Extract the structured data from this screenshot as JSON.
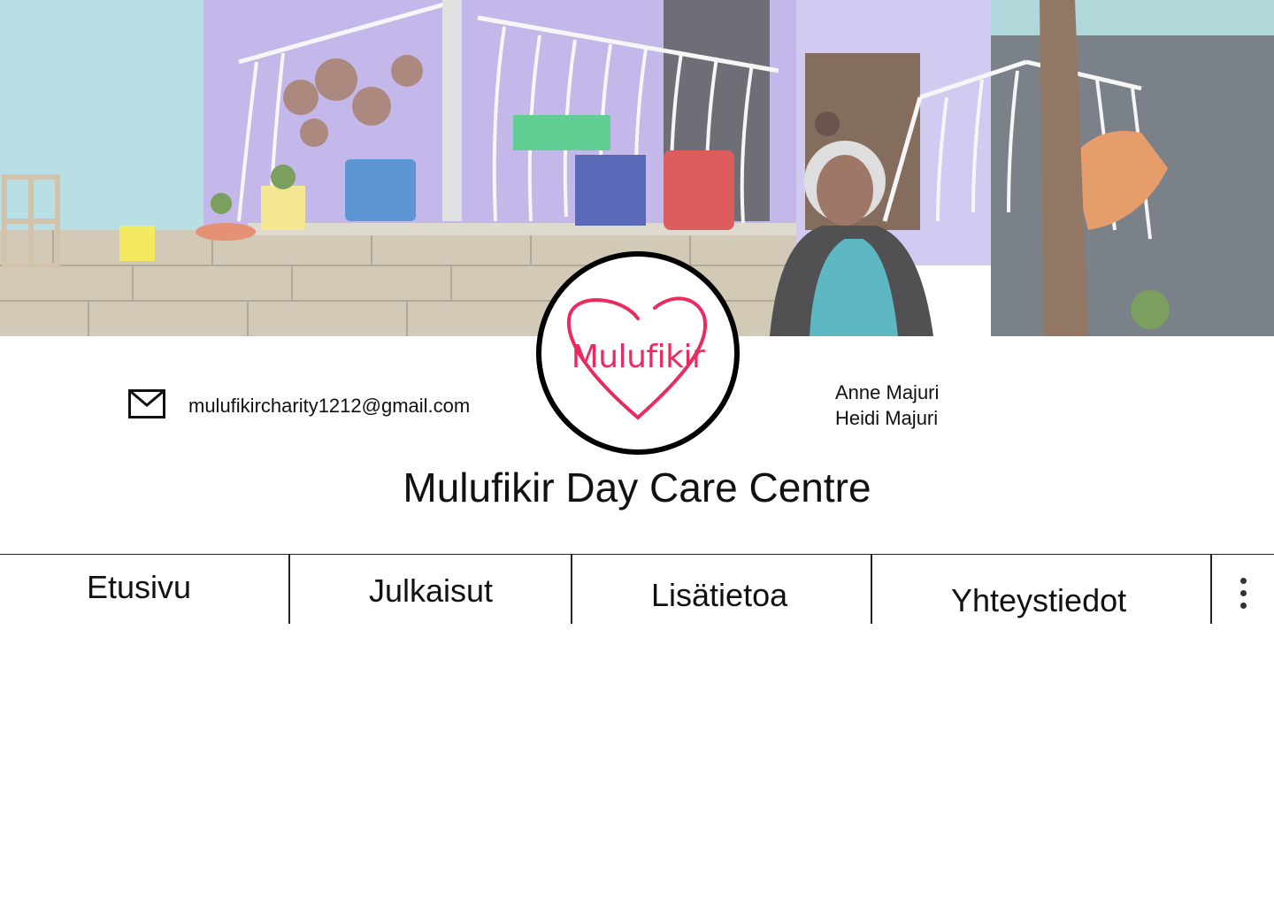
{
  "hero": {
    "image": "day-care-centre-photo"
  },
  "logo": {
    "text": "Mulufikir",
    "color": "#ea2b5e"
  },
  "contact": {
    "icon": "mail-icon",
    "email": "mulufikircharity1212@gmail.com",
    "people": [
      "Anne Majuri",
      "Heidi Majuri"
    ]
  },
  "title": "Mulufikir Day Care Centre",
  "nav": {
    "items": [
      {
        "label": "Etusivu"
      },
      {
        "label": "Julkaisut"
      },
      {
        "label": "Lisätietoa"
      },
      {
        "label": "Yhteystiedot"
      }
    ],
    "more_icon": "more-vertical-icon"
  }
}
